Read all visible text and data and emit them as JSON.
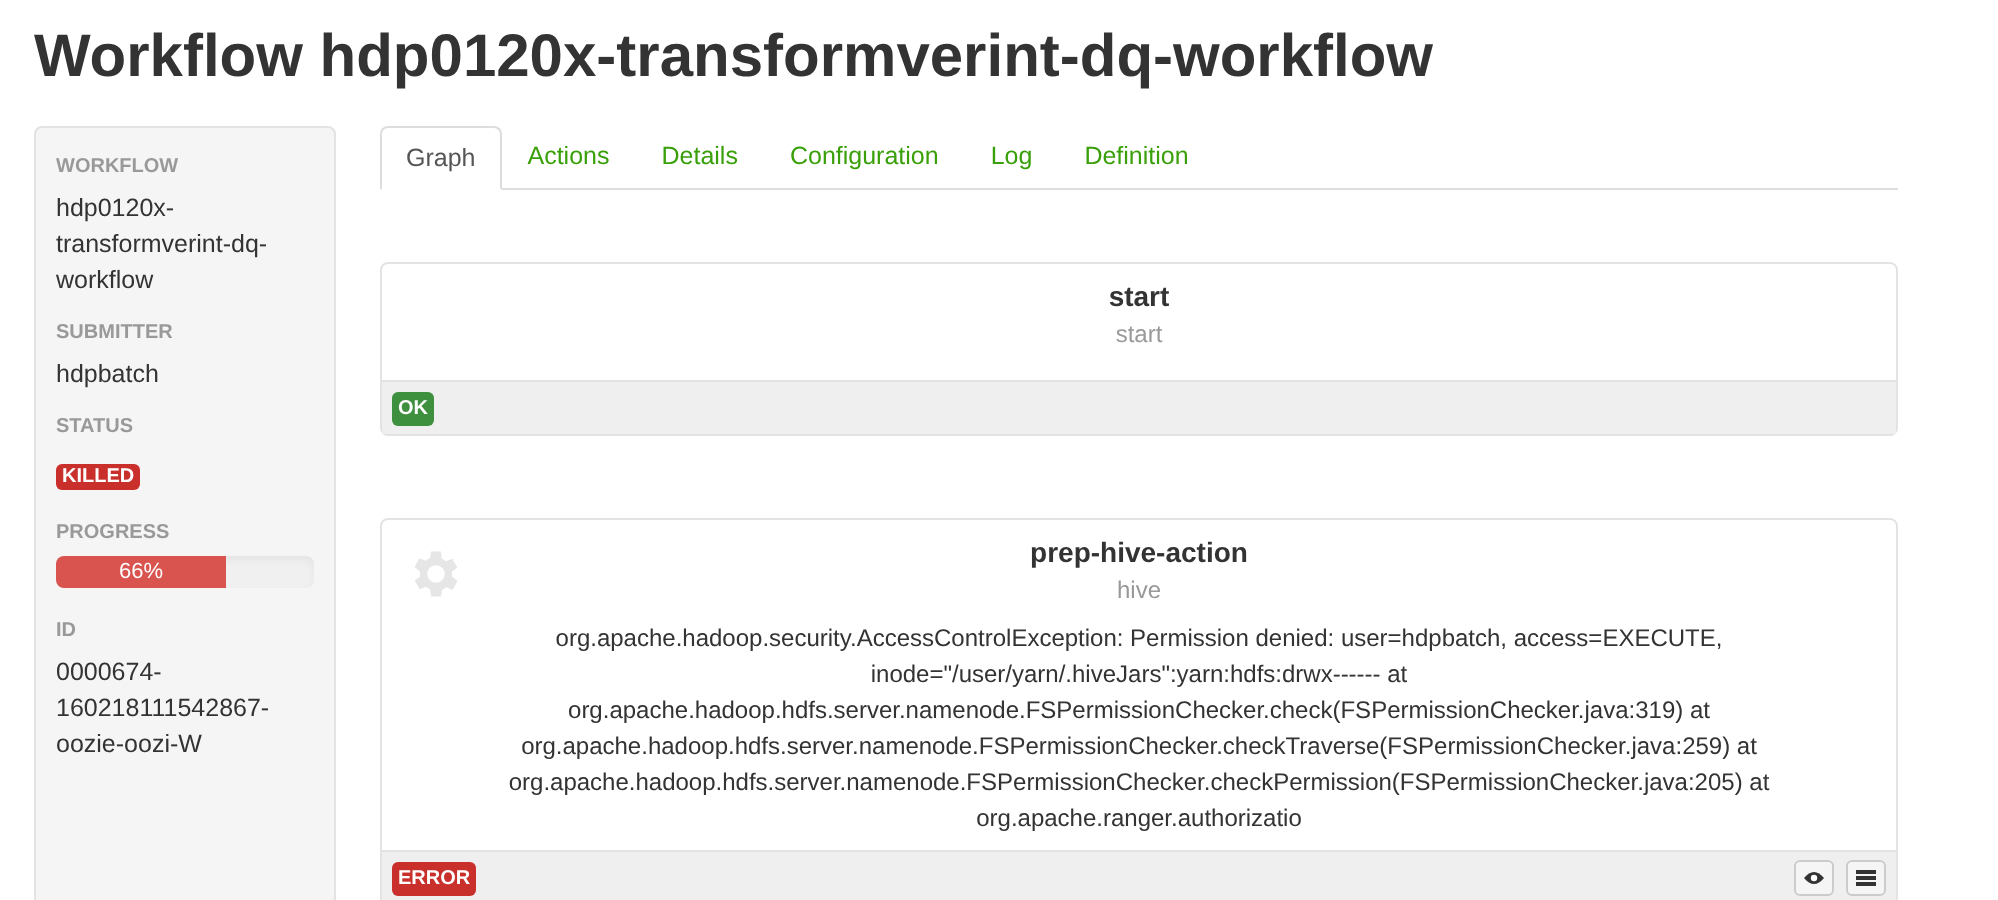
{
  "title": "Workflow hdp0120x-transformverint-dq-workflow",
  "sidebar": {
    "workflow_label": "WORKFLOW",
    "workflow": "hdp0120x-transformverint-dq-workflow",
    "submitter_label": "SUBMITTER",
    "submitter": "hdpbatch",
    "status_label": "STATUS",
    "status": "KILLED",
    "progress_label": "PROGRESS",
    "progress": {
      "level": 0.66,
      "reading": "66%"
    },
    "id_label": "ID",
    "id": "0000674-160218111542867-oozie-oozi-W"
  },
  "tabs": [
    {
      "label": "Graph",
      "selected": true
    },
    {
      "label": "Actions",
      "selected": false
    },
    {
      "label": "Details",
      "selected": false
    },
    {
      "label": "Configuration",
      "selected": false
    },
    {
      "label": "Log",
      "selected": false
    },
    {
      "label": "Definition",
      "selected": false
    }
  ],
  "nodes": [
    {
      "kind": "control",
      "name": "start",
      "type": "start",
      "status": {
        "label": "OK",
        "kind": "ok"
      }
    },
    {
      "kind": "action",
      "name": "prep-hive-action",
      "type": "hive",
      "message": "org.apache.hadoop.security.AccessControlException: Permission denied: user=hdpbatch, access=EXECUTE, inode=\"/user/yarn/.hiveJars\":yarn:hdfs:drwx------ at org.apache.hadoop.hdfs.server.namenode.FSPermissionChecker.check(FSPermissionChecker.java:319) at org.apache.hadoop.hdfs.server.namenode.FSPermissionChecker.checkTraverse(FSPermissionChecker.java:259) at org.apache.hadoop.hdfs.server.namenode.FSPermissionChecker.checkPermission(FSPermissionChecker.java:205) at org.apache.ranger.authorizatio",
      "status": {
        "label": "ERROR",
        "kind": "error"
      }
    }
  ]
}
